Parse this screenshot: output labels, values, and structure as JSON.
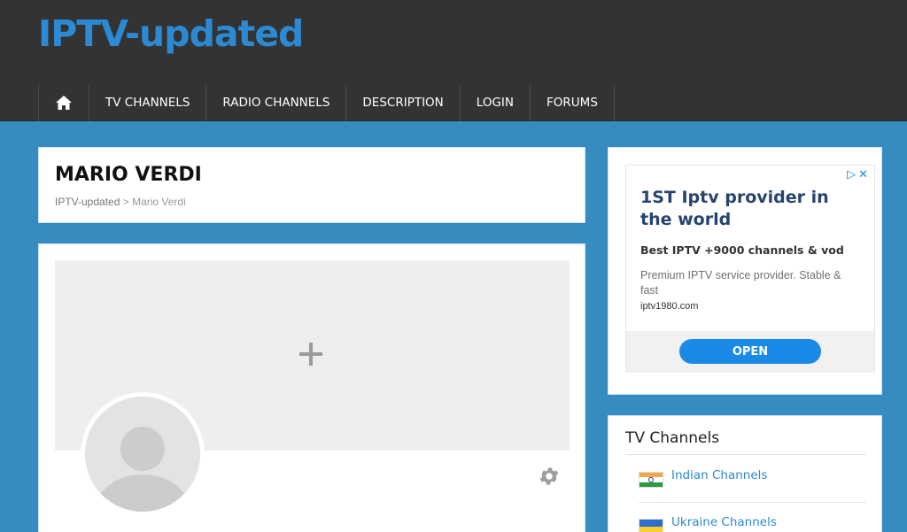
{
  "site": {
    "title": "IPTV-updated"
  },
  "nav": {
    "home_icon": "home-icon",
    "items": [
      {
        "label": "TV CHANNELS"
      },
      {
        "label": "RADIO CHANNELS"
      },
      {
        "label": "DESCRIPTION"
      },
      {
        "label": "LOGIN"
      },
      {
        "label": "FORUMS"
      }
    ]
  },
  "page": {
    "title": "MARIO VERDI",
    "breadcrumb": {
      "home": "IPTV-updated",
      "separator": " > ",
      "current": "Mario Verdi"
    }
  },
  "profile": {
    "cover_add_icon": "plus-icon",
    "avatar_icon": "avatar-placeholder-icon",
    "settings_icon": "gear-icon"
  },
  "ad": {
    "choices_icon": "ad-choices-icon",
    "choices_text": "▷✕",
    "headline": "1ST Iptv provider in the world",
    "subheadline": "Best IPTV +9000 channels & vod",
    "description": "Premium IPTV service provider. Stable & fast",
    "url": "iptv1980.com",
    "button_label": "OPEN"
  },
  "channels_widget": {
    "title": "TV Channels",
    "items": [
      {
        "label": "Indian Channels",
        "flag": "india-flag-icon"
      },
      {
        "label": "Ukraine Channels",
        "flag": "ukraine-flag-icon"
      }
    ]
  },
  "colors": {
    "header_bg": "#333333",
    "brand_blue": "#2b8ad3",
    "page_bg": "#368bc1",
    "button_blue": "#1a8ae6"
  }
}
